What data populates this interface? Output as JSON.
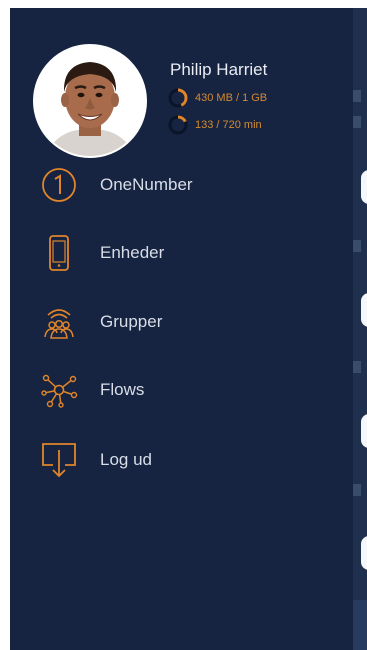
{
  "profile": {
    "name": "Philip Harriet",
    "data_usage": "430 MB / 1 GB",
    "data_usage_fraction": 0.43,
    "minutes_usage": "133 / 720 min",
    "minutes_usage_fraction": 0.18
  },
  "menu": {
    "items": [
      {
        "label": "OneNumber",
        "icon": "one-number-icon"
      },
      {
        "label": "Enheder",
        "icon": "phone-device-icon"
      },
      {
        "label": "Grupper",
        "icon": "group-icon"
      },
      {
        "label": "Flows",
        "icon": "flows-network-icon"
      },
      {
        "label": "Log ud",
        "icon": "logout-icon"
      }
    ]
  },
  "colors": {
    "background": "#162441",
    "accent": "#e0852a",
    "text": "#d8dde7"
  }
}
